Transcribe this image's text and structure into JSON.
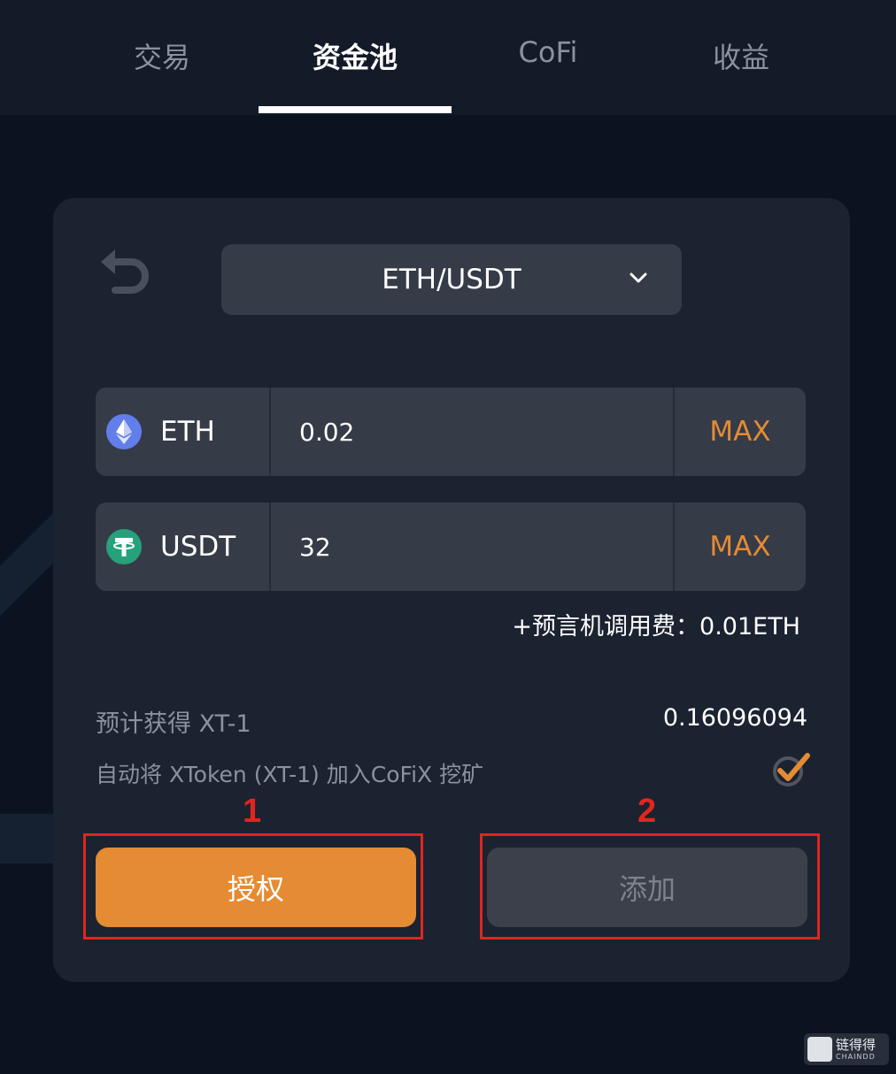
{
  "tabs": [
    {
      "label": "交易"
    },
    {
      "label": "资金池"
    },
    {
      "label": "CoFi"
    },
    {
      "label": "收益"
    }
  ],
  "active_tab": "资金池",
  "card": {
    "pair_select": {
      "value": "ETH/USDT"
    },
    "inputs": [
      {
        "token": "ETH",
        "value": "0.02",
        "max_label": "MAX"
      },
      {
        "token": "USDT",
        "value": "32",
        "max_label": "MAX"
      }
    ],
    "fee_line": "+预言机调用费：0.01ETH",
    "estimate": {
      "label": "预计获得 XT-1",
      "value": "0.16096094"
    },
    "auto_mining": {
      "label": "自动将 XToken (XT-1) 加入CoFiX 挖矿",
      "checked": true
    },
    "annotations": {
      "step1": "1",
      "step2": "2"
    },
    "buttons": {
      "approve": "授权",
      "add": "添加"
    }
  },
  "watermark": {
    "cn": "链得得",
    "en": "CHAINDD"
  },
  "colors": {
    "accent": "#e48b33",
    "annotation_red": "#e0261f",
    "eth_icon": "#627eea",
    "usdt_icon": "#26a17b"
  },
  "icons": {
    "back": "undo-arrow-icon",
    "dropdown": "chevron-down-icon",
    "eth": "ethereum-icon",
    "usdt": "tether-icon",
    "check": "checkmark-icon"
  }
}
